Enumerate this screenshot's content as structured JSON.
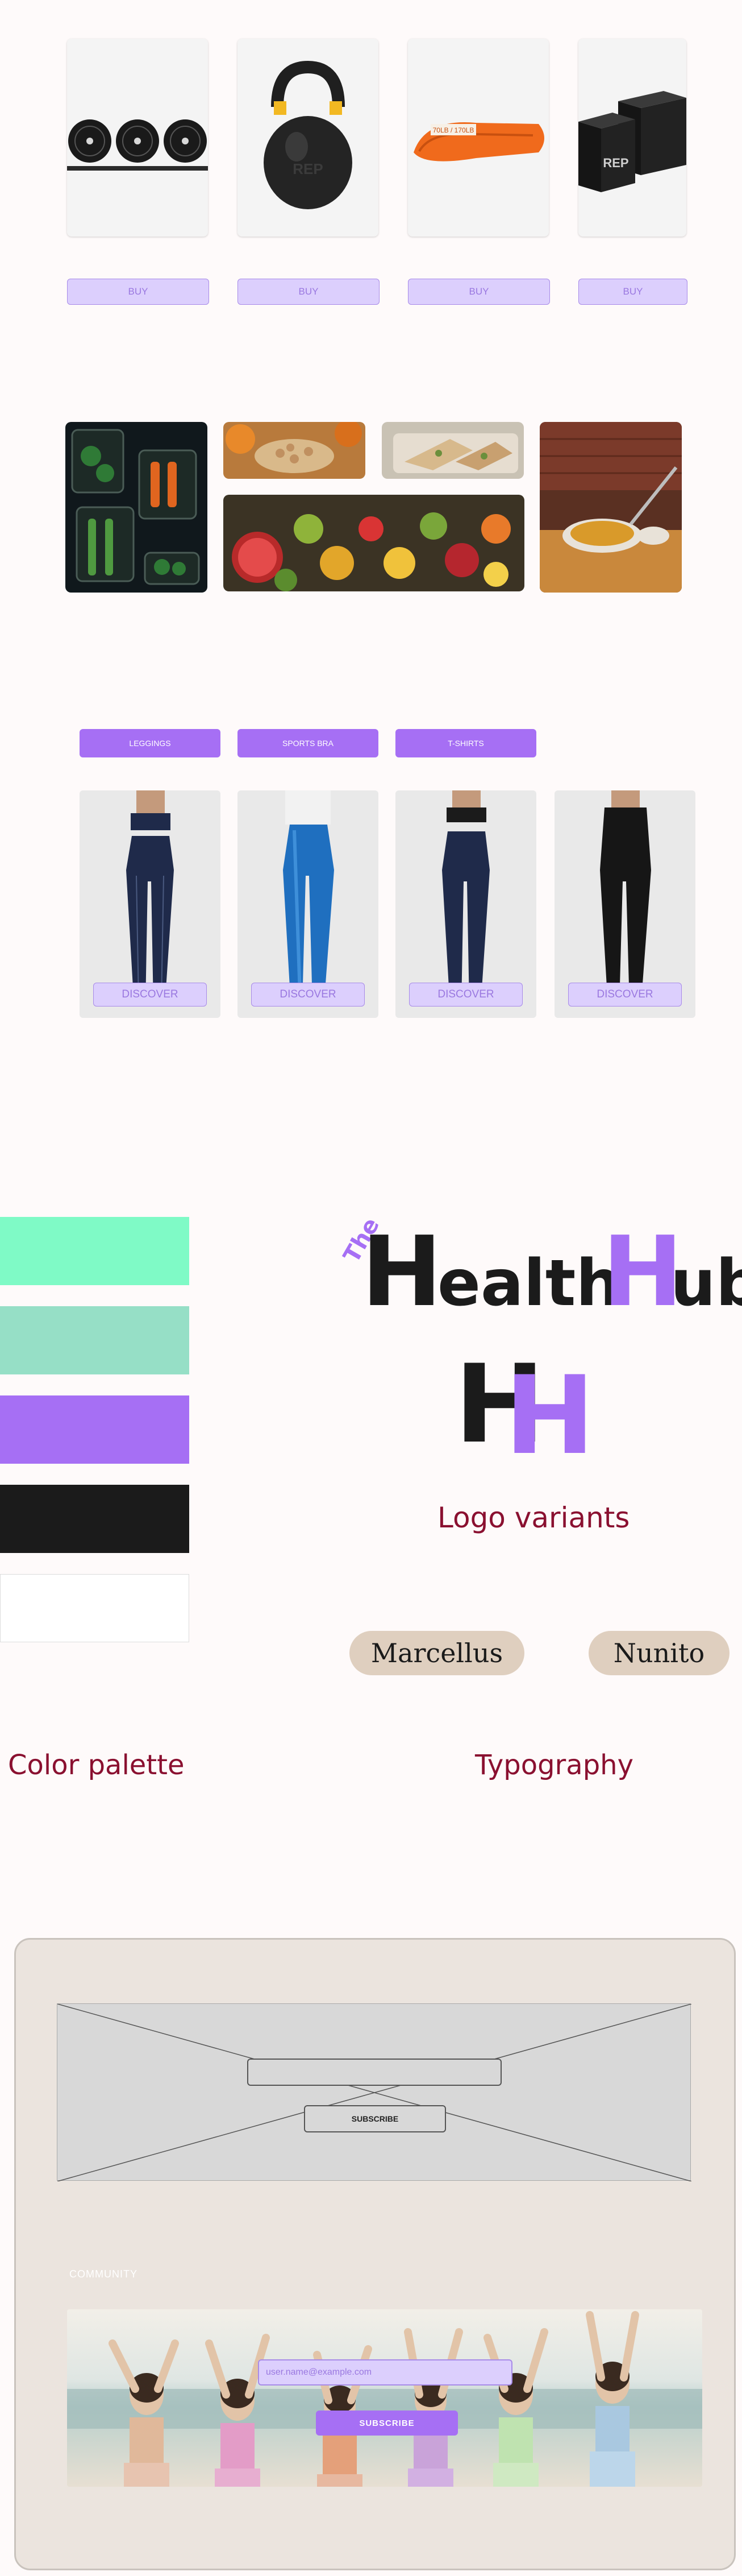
{
  "products": {
    "buy_label": "BUY",
    "items": [
      {
        "name": "weight plates"
      },
      {
        "name": "kettlebell",
        "brand": "REP"
      },
      {
        "name": "resistance band",
        "tag": "70LB / 170LB"
      },
      {
        "name": "boxed equipment",
        "brand": "REP"
      }
    ]
  },
  "food_gallery": {
    "tiles": [
      "vegetable prep",
      "nuts",
      "wraps",
      "fruits",
      "soup"
    ]
  },
  "clothing": {
    "categories": [
      "LEGGINGS",
      "SPORTS BRA",
      "T-SHIRTS"
    ],
    "discover_label": "DISCOVER",
    "items": [
      {
        "color": "#1f2a4a"
      },
      {
        "color": "#1f6fbf"
      },
      {
        "color": "#1f2a4a"
      },
      {
        "color": "#161616"
      }
    ]
  },
  "palette": {
    "title": "Color palette",
    "colors": [
      "#7ffac6",
      "#96dfc6",
      "#a66ff4",
      "#1b1b1b",
      "#ffffff"
    ]
  },
  "logo": {
    "the": "The",
    "health": "ealth",
    "hub": "ub",
    "h1": "H",
    "h2": "H",
    "variants_label": "Logo variants",
    "accent": "#a66ff4",
    "dark": "#1b1b1b"
  },
  "typography": {
    "title": "Typography",
    "fonts": [
      "Marcellus",
      "Nunito"
    ]
  },
  "newsletter": {
    "subscribe_label": "SUBSCRIBE",
    "community_label": "COMMUNITY",
    "email_placeholder": "user.name@example.com",
    "subscribe_button": "SUBSCRIBE"
  }
}
